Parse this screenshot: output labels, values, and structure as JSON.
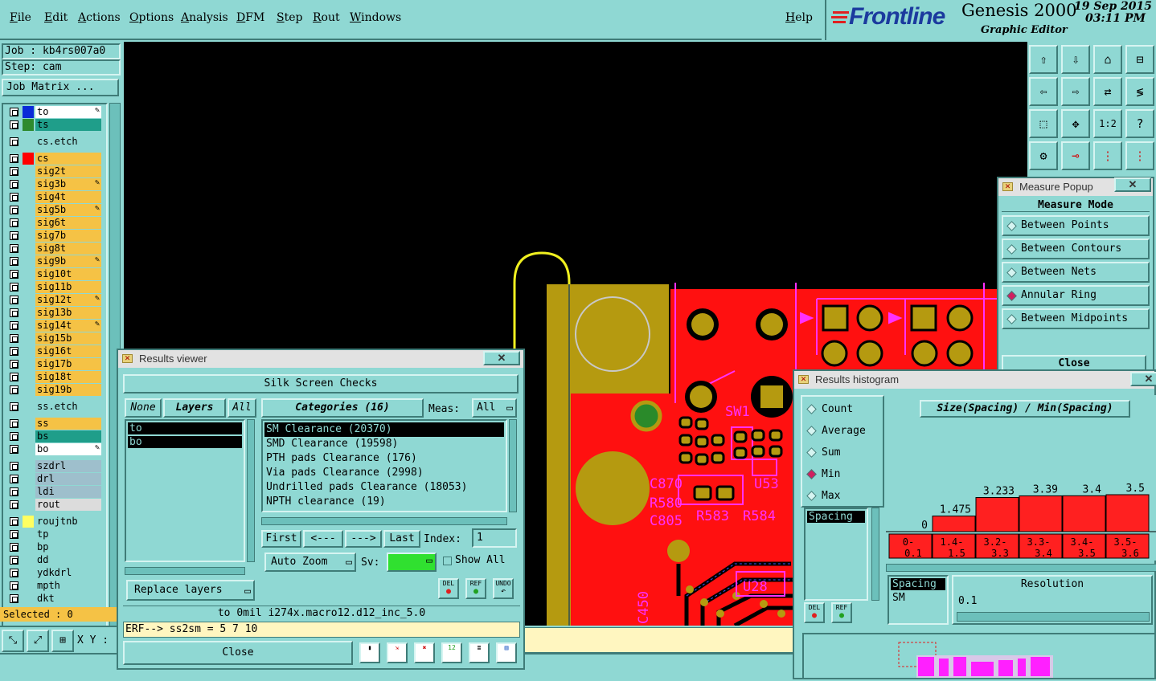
{
  "menu": {
    "items": [
      "File",
      "Edit",
      "Actions",
      "Options",
      "Analysis",
      "DFM",
      "Step",
      "Rout",
      "Windows"
    ],
    "help": "Help"
  },
  "brand": {
    "logo": "Frontline",
    "product": "Genesis 2000",
    "subtitle": "Graphic Editor",
    "date": "19  Sep 2015",
    "time": "03:11 PM"
  },
  "job": {
    "job_label": "Job : kb4rs007a0",
    "step_label": "Step: cam",
    "matrix_button": "Job Matrix ..."
  },
  "layers": [
    {
      "name": "to",
      "color": "#0a2ad8",
      "bg": "#ffffff",
      "edit": true
    },
    {
      "name": "ts",
      "color": "#2e8a2e",
      "bg": "#1f9e8a",
      "edit": false
    },
    {
      "name": "cs.etch",
      "color": "#8fd8d3",
      "bg": "#8fd8d3",
      "edit": false
    },
    {
      "name": "cs",
      "color": "#ff0000",
      "bg": "#f5c245",
      "edit": false
    },
    {
      "name": "sig2t",
      "color": "#8fd8d3",
      "bg": "#f5c245",
      "edit": false
    },
    {
      "name": "sig3b",
      "color": "#8fd8d3",
      "bg": "#f5c245",
      "edit": true
    },
    {
      "name": "sig4t",
      "color": "#8fd8d3",
      "bg": "#f5c245",
      "edit": false
    },
    {
      "name": "sig5b",
      "color": "#8fd8d3",
      "bg": "#f5c245",
      "edit": true
    },
    {
      "name": "sig6t",
      "color": "#8fd8d3",
      "bg": "#f5c245",
      "edit": false
    },
    {
      "name": "sig7b",
      "color": "#8fd8d3",
      "bg": "#f5c245",
      "edit": false
    },
    {
      "name": "sig8t",
      "color": "#8fd8d3",
      "bg": "#f5c245",
      "edit": false
    },
    {
      "name": "sig9b",
      "color": "#8fd8d3",
      "bg": "#f5c245",
      "edit": true
    },
    {
      "name": "sig10t",
      "color": "#8fd8d3",
      "bg": "#f5c245",
      "edit": false
    },
    {
      "name": "sig11b",
      "color": "#8fd8d3",
      "bg": "#f5c245",
      "edit": false
    },
    {
      "name": "sig12t",
      "color": "#8fd8d3",
      "bg": "#f5c245",
      "edit": true
    },
    {
      "name": "sig13b",
      "color": "#8fd8d3",
      "bg": "#f5c245",
      "edit": false
    },
    {
      "name": "sig14t",
      "color": "#8fd8d3",
      "bg": "#f5c245",
      "edit": true
    },
    {
      "name": "sig15b",
      "color": "#8fd8d3",
      "bg": "#f5c245",
      "edit": false
    },
    {
      "name": "sig16t",
      "color": "#8fd8d3",
      "bg": "#f5c245",
      "edit": false
    },
    {
      "name": "sig17b",
      "color": "#8fd8d3",
      "bg": "#f5c245",
      "edit": false
    },
    {
      "name": "sig18t",
      "color": "#8fd8d3",
      "bg": "#f5c245",
      "edit": false
    },
    {
      "name": "sig19b",
      "color": "#8fd8d3",
      "bg": "#f5c245",
      "edit": false
    },
    {
      "name": "ss.etch",
      "color": "#8fd8d3",
      "bg": "#8fd8d3",
      "edit": false
    },
    {
      "name": "ss",
      "color": "#8fd8d3",
      "bg": "#f5c245",
      "edit": false
    },
    {
      "name": "bs",
      "color": "#8fd8d3",
      "bg": "#1f9e8a",
      "edit": false
    },
    {
      "name": "bo",
      "color": "#8fd8d3",
      "bg": "#ffffff",
      "edit": true
    },
    {
      "name": "szdrl",
      "color": "#8fd8d3",
      "bg": "#9ebfcc",
      "edit": false
    },
    {
      "name": "drl",
      "color": "#8fd8d3",
      "bg": "#9ebfcc",
      "edit": false
    },
    {
      "name": "ldi",
      "color": "#8fd8d3",
      "bg": "#9ebfcc",
      "edit": false
    },
    {
      "name": "rout",
      "color": "#8fd8d3",
      "bg": "#dcdcdc",
      "edit": false
    },
    {
      "name": "roujtnb",
      "color": "#ffff60",
      "bg": "#8fd8d3",
      "edit": false
    },
    {
      "name": "tp",
      "color": "#8fd8d3",
      "bg": "#8fd8d3",
      "edit": false
    },
    {
      "name": "bp",
      "color": "#8fd8d3",
      "bg": "#8fd8d3",
      "edit": false
    },
    {
      "name": "dd",
      "color": "#8fd8d3",
      "bg": "#8fd8d3",
      "edit": false
    },
    {
      "name": "ydkdrl",
      "color": "#8fd8d3",
      "bg": "#8fd8d3",
      "edit": false
    },
    {
      "name": "mpth",
      "color": "#8fd8d3",
      "bg": "#8fd8d3",
      "edit": false
    },
    {
      "name": "dkt",
      "color": "#8fd8d3",
      "bg": "#8fd8d3",
      "edit": false
    }
  ],
  "status": {
    "selected": "Selected : 0",
    "xy_label": "X Y :"
  },
  "pcb_labels": {
    "sw1": "SW1",
    "c870": "C870",
    "r580": "R580",
    "c805": "C805",
    "r583": "R583",
    "r584": "R584",
    "u53": "U53",
    "c450": "C450",
    "u28": "U28"
  },
  "measure": {
    "title": "Measure Popup",
    "mode_label": "Measure Mode",
    "options": [
      {
        "label": "Between Points",
        "selected": false
      },
      {
        "label": "Between Contours",
        "selected": false
      },
      {
        "label": "Between Nets",
        "selected": false
      },
      {
        "label": "Annular Ring",
        "selected": true
      },
      {
        "label": "Between Midpoints",
        "selected": false
      }
    ],
    "close": "Close"
  },
  "results": {
    "title": "Results viewer",
    "heading": "Silk Screen Checks",
    "none_btn": "None",
    "layers_btn": "Layers",
    "all_btn": "All",
    "categories_btn": "Categories (16)",
    "meas_label": "Meas:",
    "meas_value": "All",
    "layers_list": [
      "to",
      "bo"
    ],
    "categories": [
      "SM Clearance (20370)",
      "SMD Clearance (19598)",
      "PTH pads Clearance (176)",
      "Via pads Clearance (2998)",
      "Undrilled pads Clearance (18053)",
      "NPTH clearance (19)"
    ],
    "first": "First",
    "prev": "<---",
    "next": "--->",
    "last": "Last",
    "index_label": "Index:",
    "index_value": "1",
    "auto_zoom": "Auto Zoom",
    "sv_label": "Sv:",
    "show_all": "Show All",
    "replace_layers": "Replace layers",
    "del": "DEL",
    "ref": "REF",
    "undo": "UNDO",
    "info_line": "to 0mil  i274x.macro12.d12_inc_5.0",
    "erf_line": "ERF--> ss2sm = 5 7 10",
    "close": "Close"
  },
  "histogram": {
    "title": "Results histogram",
    "modes": [
      {
        "label": "Count",
        "selected": false
      },
      {
        "label": "Average",
        "selected": false
      },
      {
        "label": "Sum",
        "selected": false
      },
      {
        "label": "Min",
        "selected": true
      },
      {
        "label": "Max",
        "selected": false
      }
    ],
    "list_item": "Spacing",
    "chart_title": "Size(Spacing) / Min(Spacing)",
    "del": "DEL",
    "ref": "REF",
    "field_selected": "Spacing",
    "field_sub": "SM",
    "resolution_label": "Resolution",
    "resolution_value": "0.1"
  },
  "chart_data": {
    "type": "bar",
    "title": "Size(Spacing) / Min(Spacing)",
    "categories": [
      "0-0.1",
      "1.4-1.5",
      "3.2-3.3",
      "3.3-3.4",
      "3.4-3.5",
      "3.5-3.6"
    ],
    "values": [
      0,
      1.475,
      3.233,
      3.39,
      3.4,
      3.5
    ],
    "value_labels": [
      "0",
      "1.475",
      "3.233",
      "3.39",
      "3.4",
      "3.5"
    ],
    "ylim": [
      0,
      3.5
    ],
    "grid": false
  },
  "colors": {
    "panel": "#8fd8d3",
    "pcb_red": "#ff1010",
    "pcb_gold": "#b59a10",
    "pcb_magenta": "#ff30ff",
    "bar_red": "#ff2020"
  }
}
